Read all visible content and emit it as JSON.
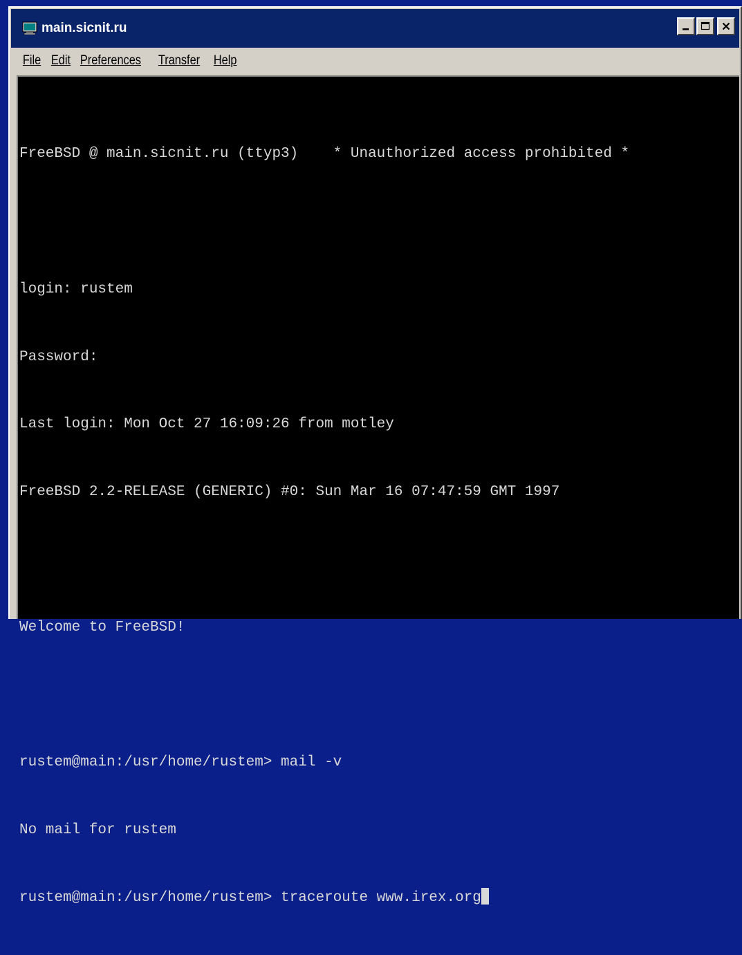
{
  "window": {
    "title": "main.sicnit.ru",
    "title_icon": "terminal-icon"
  },
  "menu": {
    "items": [
      {
        "label": "File"
      },
      {
        "label": "Edit"
      },
      {
        "label": "Preferences"
      },
      {
        "label": "Transfer"
      },
      {
        "label": "Help"
      }
    ]
  },
  "terminal": {
    "lines": [
      "FreeBSD @ main.sicnit.ru (ttyp3)    * Unauthorized access prohibited *",
      "",
      "login: rustem",
      "Password:",
      "Last login: Mon Oct 27 16:09:26 from motley",
      "FreeBSD 2.2-RELEASE (GENERIC) #0: Sun Mar 16 07:47:59 GMT 1997",
      "",
      "Welcome to FreeBSD!",
      "",
      "rustem@main:/usr/home/rustem> mail -v",
      "No mail for rustem",
      "rustem@main:/usr/home/rustem> traceroute www.irex.org"
    ]
  },
  "colors": {
    "desktop": "#0a1f8a",
    "titlebar": "#0a246a",
    "terminal_bg": "#000000",
    "terminal_fg": "#d8d8d8"
  }
}
